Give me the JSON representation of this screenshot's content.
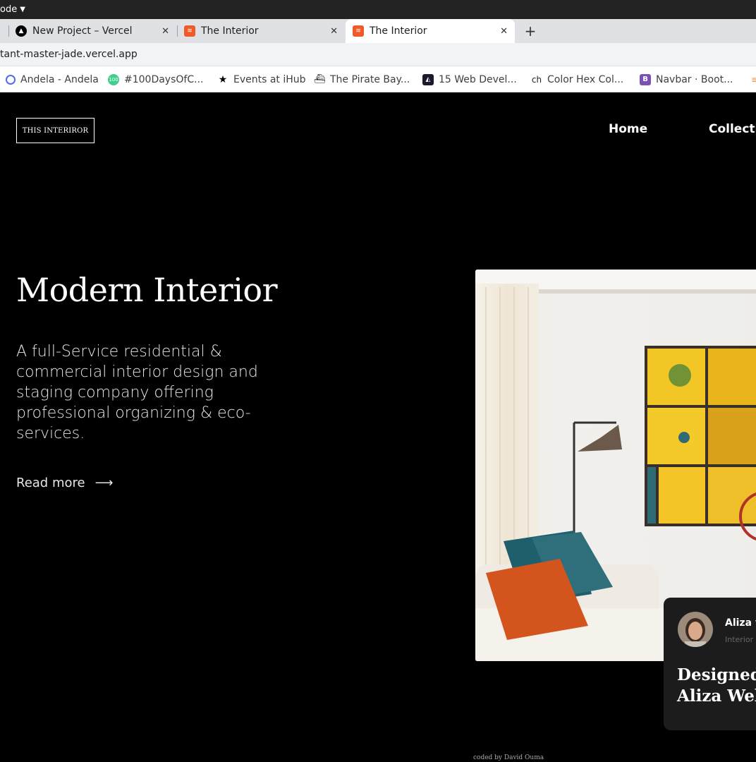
{
  "browser": {
    "topbar_text": "ode",
    "tabs": [
      {
        "title": "New Project – Vercel",
        "favicon": "vercel-icon"
      },
      {
        "title": "The Interior",
        "favicon": "interior-icon"
      },
      {
        "title": "The Interior",
        "favicon": "interior-icon",
        "active": true
      }
    ],
    "url": "tant-master-jade.vercel.app",
    "bookmarks": [
      {
        "label": "Andela - Andela",
        "icon": "andela-icon"
      },
      {
        "label": "#100DaysOfC...",
        "icon": "100days-icon"
      },
      {
        "label": "Events at iHub",
        "icon": "star-icon"
      },
      {
        "label": "The Pirate Bay...",
        "icon": "pirate-ship-icon"
      },
      {
        "label": "15 Web Devel...",
        "icon": "webdev-icon"
      },
      {
        "label": "Color Hex Col...",
        "icon": "ch-icon"
      },
      {
        "label": "Navbar · Boot...",
        "icon": "bootstrap-icon"
      }
    ]
  },
  "site": {
    "logo": "THIS INTERIROR",
    "nav": [
      "Home",
      "Collecti"
    ],
    "hero": {
      "title": "Modern Interior",
      "text": "A full-Service residential & commercial interior design and staging company offering professional organizing & eco-services.",
      "read_more": "Read more",
      "read_more_arrow": "⟶"
    },
    "card": {
      "name": "Aliza v",
      "role": "Interior",
      "title_line1": "Designed",
      "title_line2": "Aliza Webl"
    },
    "footer": "coded by David Ouma"
  },
  "colors": {
    "background": "#000000",
    "card_bg": "#1c1c1c",
    "interior_favicon": "#f05a28",
    "bootstrap": "#7952b3"
  }
}
